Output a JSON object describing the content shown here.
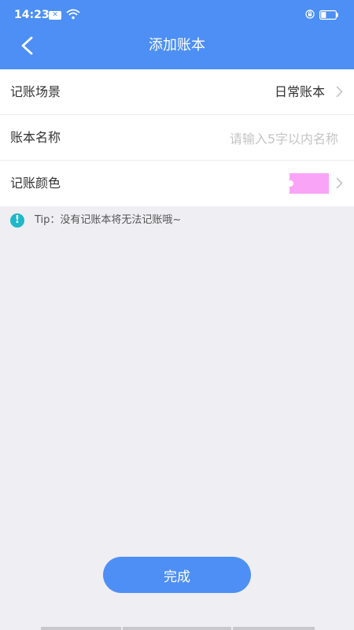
{
  "status_bar": {
    "time": "14:23",
    "notification_icon": "close-x-icon",
    "wifi_icon": "wifi-icon",
    "lock_icon": "rotation-lock-icon",
    "battery_icon": "battery-icon",
    "battery_level": 0.35
  },
  "nav": {
    "title": "添加账本",
    "back_icon": "chevron-left-icon"
  },
  "form": {
    "scene": {
      "label": "记账场景",
      "value": "日常账本"
    },
    "name": {
      "label": "账本名称",
      "placeholder": "请输入5字以内名称",
      "value": ""
    },
    "color": {
      "label": "记账颜色",
      "swatch_color": "#f9a4f6"
    }
  },
  "tip": {
    "icon": "exclamation-icon",
    "text": "Tip：没有记账本将无法记账哦~"
  },
  "done_button": {
    "label": "完成"
  },
  "colors": {
    "primary": "#4d8ff5",
    "background": "#efeef2",
    "tip_icon": "#1fb8c9"
  }
}
